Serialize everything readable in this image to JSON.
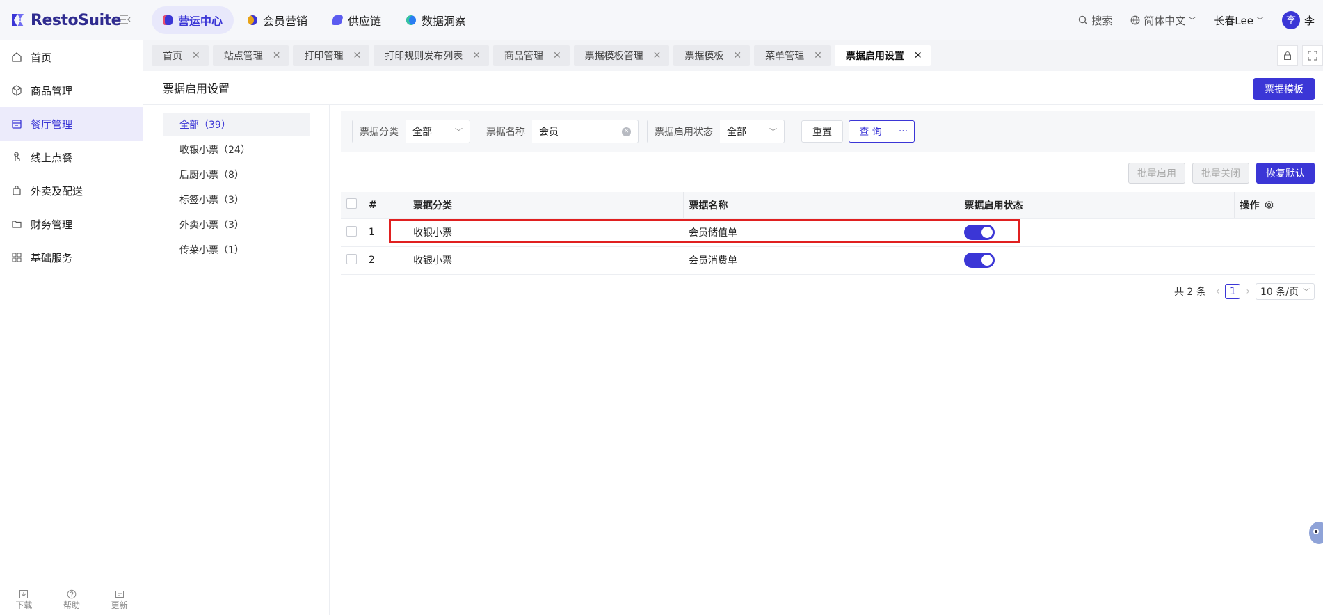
{
  "app": {
    "name": "RestoSuite"
  },
  "modules": [
    {
      "label": "营运中心",
      "active": true,
      "color": "#3b36d6"
    },
    {
      "label": "会员营销",
      "active": false,
      "color": "#e8a317"
    },
    {
      "label": "供应链",
      "active": false,
      "color": "#5b5bf0"
    },
    {
      "label": "数据洞察",
      "active": false,
      "color": "#2a7df2"
    }
  ],
  "topright": {
    "search": "搜索",
    "language": "简体中文",
    "store": "长春Lee",
    "avatar_char": "李",
    "user": "李"
  },
  "sidebar": {
    "items": [
      {
        "label": "首页",
        "icon": "home-icon"
      },
      {
        "label": "商品管理",
        "icon": "box-icon"
      },
      {
        "label": "餐厅管理",
        "icon": "store-icon",
        "active": true
      },
      {
        "label": "线上点餐",
        "icon": "touch-icon"
      },
      {
        "label": "外卖及配送",
        "icon": "bag-icon"
      },
      {
        "label": "财务管理",
        "icon": "folder-icon"
      },
      {
        "label": "基础服务",
        "icon": "grid-icon"
      }
    ],
    "footer": [
      {
        "label": "下载",
        "icon": "download-icon"
      },
      {
        "label": "帮助",
        "icon": "help-icon"
      },
      {
        "label": "更新",
        "icon": "update-icon"
      }
    ]
  },
  "tabs": [
    {
      "label": "首页"
    },
    {
      "label": "站点管理"
    },
    {
      "label": "打印管理"
    },
    {
      "label": "打印规则发布列表"
    },
    {
      "label": "商品管理"
    },
    {
      "label": "票据模板管理"
    },
    {
      "label": "票据模板"
    },
    {
      "label": "菜单管理"
    },
    {
      "label": "票据启用设置",
      "active": true
    }
  ],
  "page": {
    "title": "票据启用设置",
    "template_button": "票据模板"
  },
  "categories": [
    {
      "label": "全部（39）",
      "active": true
    },
    {
      "label": "收银小票（24）"
    },
    {
      "label": "后厨小票（8）"
    },
    {
      "label": "标签小票（3）"
    },
    {
      "label": "外卖小票（3）"
    },
    {
      "label": "传菜小票（1）"
    }
  ],
  "filters": {
    "category": {
      "label": "票据分类",
      "value": "全部"
    },
    "name": {
      "label": "票据名称",
      "value": "会员"
    },
    "status": {
      "label": "票据启用状态",
      "value": "全部"
    },
    "reset": "重置",
    "query": "查 询",
    "more": "···"
  },
  "actions": {
    "batch_enable": "批量启用",
    "batch_disable": "批量关闭",
    "restore": "恢复默认"
  },
  "table": {
    "headers": {
      "index": "#",
      "category": "票据分类",
      "name": "票据名称",
      "status": "票据启用状态",
      "ops": "操作"
    },
    "rows": [
      {
        "index": "1",
        "category": "收银小票",
        "name": "会员储值单",
        "enabled": true
      },
      {
        "index": "2",
        "category": "收银小票",
        "name": "会员消费单",
        "enabled": true
      }
    ]
  },
  "pagination": {
    "total": "共 2 条",
    "current": "1",
    "page_size": "10 条/页"
  }
}
